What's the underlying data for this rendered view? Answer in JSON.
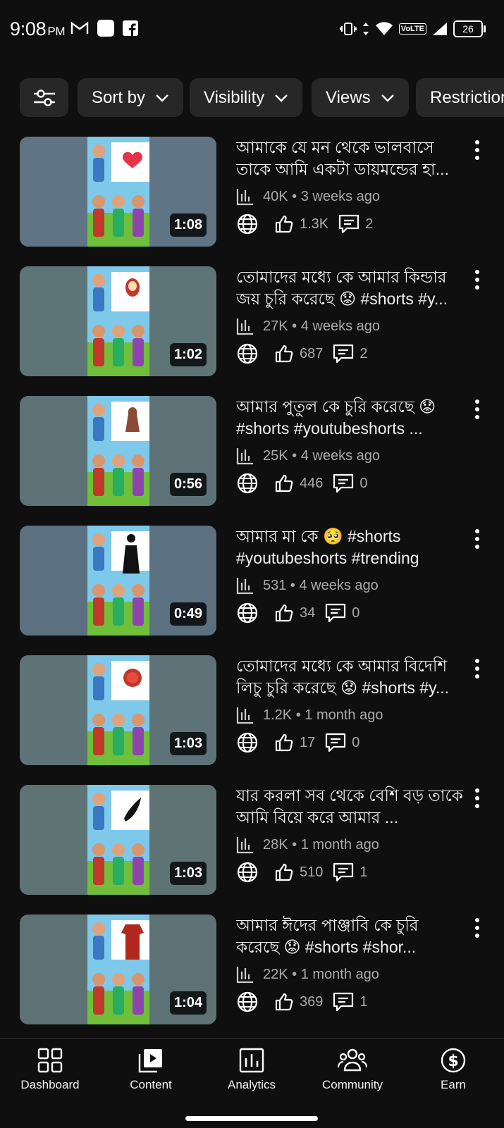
{
  "status_bar": {
    "time": "9:08",
    "ampm": "PM",
    "network": "VoLTE",
    "battery": "26"
  },
  "filters": {
    "items": [
      "Sort by",
      "Visibility",
      "Views",
      "Restrictions"
    ]
  },
  "videos": [
    {
      "title": "আমাকে যে মন থেকে ভালবাসে তাকে আমি একটা ডায়মন্ডের হা...",
      "views": "40K",
      "age": "3 weeks ago",
      "likes": "1.3K",
      "comments": "2",
      "duration": "1:08",
      "thumb_bg": "#5f7485",
      "art": "heart"
    },
    {
      "title": "তোমাদের মধ্যে কে আমার কিন্ডার জয় চুরি করেছে 😟 #shorts #y...",
      "views": "27K",
      "age": "4 weeks ago",
      "likes": "687",
      "comments": "2",
      "duration": "1:02",
      "thumb_bg": "#5e7577",
      "art": "egg"
    },
    {
      "title": "আমার পুতুল কে চুরি করেছে 😟 #shorts #youtubeshorts ...",
      "views": "25K",
      "age": "4 weeks ago",
      "likes": "446",
      "comments": "0",
      "duration": "0:56",
      "thumb_bg": "#5c7276",
      "art": "doll"
    },
    {
      "title": "আমার মা কে 🥺 #shorts #youtubeshorts #trending",
      "views": "531",
      "age": "4 weeks ago",
      "likes": "34",
      "comments": "0",
      "duration": "0:49",
      "thumb_bg": "#5b7080",
      "art": "silhouette"
    },
    {
      "title": "তোমাদের মধ্যে কে আমার বিদেশি লিচু চুরি করেছে 😟 #shorts #y...",
      "views": "1.2K",
      "age": "1 month ago",
      "likes": "17",
      "comments": "0",
      "duration": "1:03",
      "thumb_bg": "#5d7377",
      "art": "lychee"
    },
    {
      "title": "যার করলা সব থেকে বেশি বড় তাকে আমি বিয়ে করে আমার ...",
      "views": "28K",
      "age": "1 month ago",
      "likes": "510",
      "comments": "1",
      "duration": "1:03",
      "thumb_bg": "#5e7374",
      "art": "gourd"
    },
    {
      "title": "আমার ঈদের পাঞ্জাবি কে চুরি করেছে 😟 #shorts #shor...",
      "views": "22K",
      "age": "1 month ago",
      "likes": "369",
      "comments": "1",
      "duration": "1:04",
      "thumb_bg": "#5d7275",
      "art": "kurta"
    }
  ],
  "nav": [
    {
      "label": "Dashboard",
      "icon": "dashboard-icon"
    },
    {
      "label": "Content",
      "icon": "content-icon"
    },
    {
      "label": "Analytics",
      "icon": "analytics-icon"
    },
    {
      "label": "Community",
      "icon": "community-icon"
    },
    {
      "label": "Earn",
      "icon": "earn-icon"
    }
  ],
  "colors": {
    "bg": "#0f0f0f",
    "chip": "#272727",
    "muted": "#aaaaaa"
  }
}
